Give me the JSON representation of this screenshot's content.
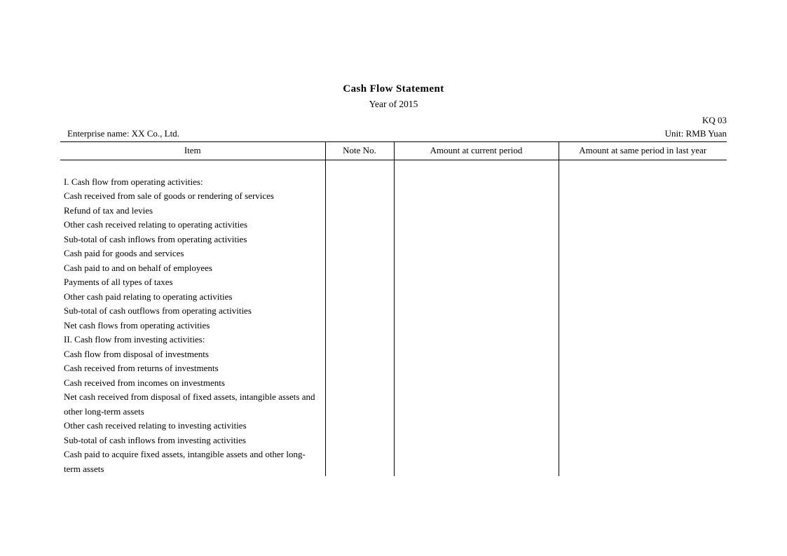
{
  "document": {
    "title": "Cash Flow Statement",
    "subtitle": "Year of 2015",
    "form_code": "KQ 03",
    "enterprise_name": "Enterprise name: XX Co., Ltd.",
    "unit": "Unit: RMB Yuan"
  },
  "table": {
    "columns": [
      {
        "key": "item",
        "label": "Item"
      },
      {
        "key": "note_no",
        "label": "Note No."
      },
      {
        "key": "current_period",
        "label": "Amount at current period"
      },
      {
        "key": "last_year",
        "label": "Amount at same period in last year"
      }
    ],
    "rows": [
      {
        "item": "I. Cash flow from operating activities:",
        "note_no": "",
        "current_period": "",
        "last_year": ""
      },
      {
        "item": "Cash received from sale of goods or rendering of services",
        "note_no": "",
        "current_period": "",
        "last_year": ""
      },
      {
        "item": "Refund of tax and levies",
        "note_no": "",
        "current_period": "",
        "last_year": ""
      },
      {
        "item": "Other cash received relating to operating activities",
        "note_no": "",
        "current_period": "",
        "last_year": ""
      },
      {
        "item": "Sub-total of cash inflows from operating activities",
        "note_no": "",
        "current_period": "",
        "last_year": ""
      },
      {
        "item": "Cash paid for goods and services",
        "note_no": "",
        "current_period": "",
        "last_year": ""
      },
      {
        "item": "Cash paid to and on behalf of employees",
        "note_no": "",
        "current_period": "",
        "last_year": ""
      },
      {
        "item": "Payments of all types of taxes",
        "note_no": "",
        "current_period": "",
        "last_year": ""
      },
      {
        "item": "Other cash paid relating to operating activities",
        "note_no": "",
        "current_period": "",
        "last_year": ""
      },
      {
        "item": "Sub-total of cash outflows from operating activities",
        "note_no": "",
        "current_period": "",
        "last_year": ""
      },
      {
        "item": "Net cash flows from operating activities",
        "note_no": "",
        "current_period": "",
        "last_year": ""
      },
      {
        "item": "II. Cash flow from investing activities:",
        "note_no": "",
        "current_period": "",
        "last_year": ""
      },
      {
        "item": "Cash flow from disposal of investments",
        "note_no": "",
        "current_period": "",
        "last_year": ""
      },
      {
        "item": "Cash received from returns of investments",
        "note_no": "",
        "current_period": "",
        "last_year": ""
      },
      {
        "item": "Cash received from incomes on investments",
        "note_no": "",
        "current_period": "",
        "last_year": ""
      },
      {
        "item": "Net cash received from disposal of fixed assets, intangible assets and other long-term assets",
        "note_no": "",
        "current_period": "",
        "last_year": "",
        "tall": true
      },
      {
        "item": "Other cash received relating to investing activities",
        "note_no": "",
        "current_period": "",
        "last_year": ""
      },
      {
        "item": "Sub-total of cash inflows from investing activities",
        "note_no": "",
        "current_period": "",
        "last_year": ""
      },
      {
        "item": "Cash paid to acquire fixed assets, intangible assets and other long-term assets",
        "note_no": "",
        "current_period": "",
        "last_year": "",
        "tall": true
      }
    ]
  }
}
